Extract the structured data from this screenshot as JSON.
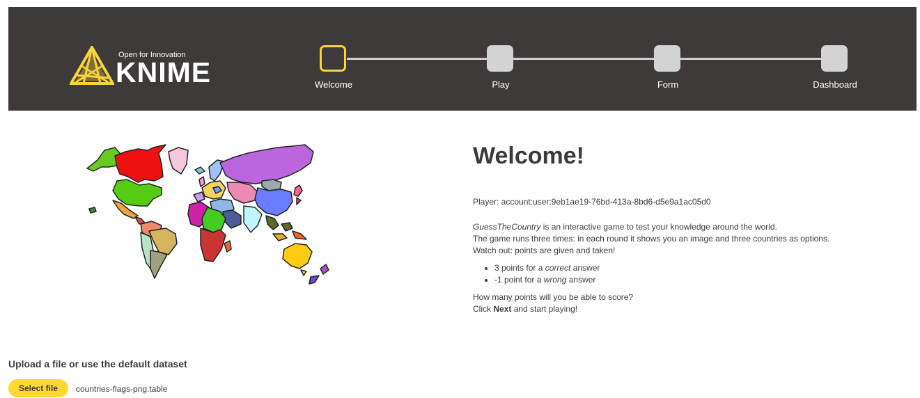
{
  "header": {
    "logo_tagline": "Open for Innovation",
    "logo_wordmark": "KNIME",
    "steps": [
      {
        "label": "Welcome",
        "active": true
      },
      {
        "label": "Play",
        "active": false
      },
      {
        "label": "Form",
        "active": false
      },
      {
        "label": "Dashboard",
        "active": false
      }
    ]
  },
  "main": {
    "title": "Welcome!",
    "player_label": "Player",
    "player_value": ": account:user:9eb1ae19-76bd-413a-8bd6-d5e9a1ac05d0",
    "intro_game_name": "GuessTheCountry",
    "intro_line1_rest": " is an interactive game to test your knowledge around the world.",
    "intro_line2": "The game runs three times: in each round it shows you an image and three countries as options.",
    "intro_line3": "Watch out: points are given and taken!",
    "bullets": [
      {
        "prefix": "3 points for a ",
        "emph": "correct",
        "suffix": " answer"
      },
      {
        "prefix": "-1 point for a ",
        "emph": "wrong",
        "suffix": " answer"
      }
    ],
    "outro_line1": "How many points will you be able to score?",
    "outro_line2_prefix": "Click ",
    "outro_line2_bold": "Next",
    "outro_line2_suffix": " and start playing!"
  },
  "upload": {
    "heading": "Upload a file or use the default dataset",
    "button_label": "Select file",
    "file_name": "countries-flags-png.table"
  },
  "colors": {
    "header_bg": "#3e3a39",
    "accent_yellow": "#f9d43a",
    "button_yellow": "#fdd835",
    "step_inactive": "#d3d3d3",
    "text_dark": "#3e3a39"
  }
}
